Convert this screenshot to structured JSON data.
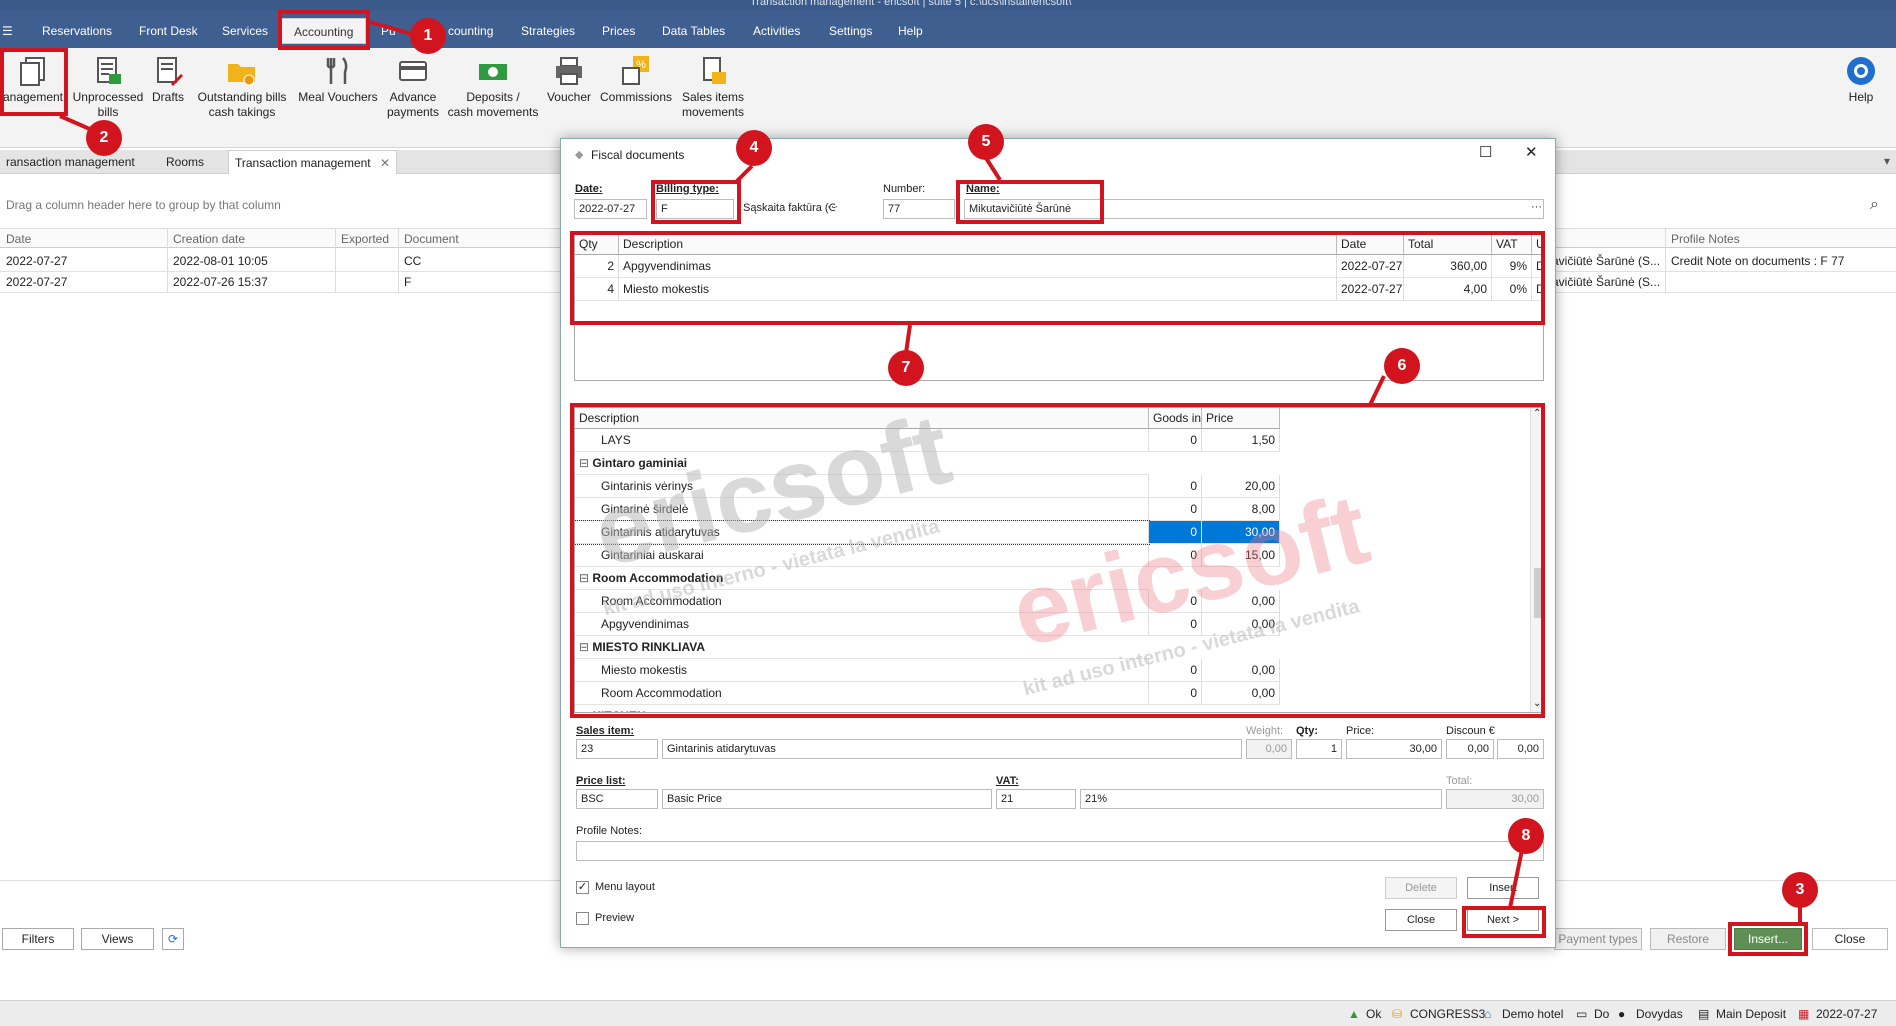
{
  "window": {
    "title": "Transaction management - ericsoft | suite 5 | c:\\ucs\\install\\ericsoft\\"
  },
  "menu": {
    "items": [
      "Reservations",
      "Front Desk",
      "Services",
      "Accounting",
      "Pu",
      "counting",
      "Strategies",
      "Prices",
      "Data Tables",
      "Activities",
      "Settings",
      "Help"
    ],
    "active": "Accounting"
  },
  "ribbon": {
    "buttons": [
      {
        "label1": "anagement",
        "label2": "",
        "icon": "documents-icon"
      },
      {
        "label1": "Unprocessed",
        "label2": "bills",
        "icon": "bills-icon"
      },
      {
        "label1": "Drafts",
        "label2": "",
        "icon": "drafts-icon"
      },
      {
        "label1": "Outstanding bills",
        "label2": "cash takings",
        "icon": "folder-coins-icon"
      },
      {
        "label1": "Meal Vouchers",
        "label2": "",
        "icon": "fork-knife-icon"
      },
      {
        "label1": "Advance",
        "label2": "payments",
        "icon": "card-icon"
      },
      {
        "label1": "Deposits /",
        "label2": "cash movements",
        "icon": "cash-icon"
      },
      {
        "label1": "Voucher",
        "label2": "",
        "icon": "printer-icon"
      },
      {
        "label1": "Commissions",
        "label2": "",
        "icon": "percent-icon"
      },
      {
        "label1": "Sales items",
        "label2": "movements",
        "icon": "sales-items-icon"
      }
    ],
    "help": "Help"
  },
  "tabs": [
    "ransaction management",
    "Rooms",
    "Transaction management"
  ],
  "group_hint": "Drag a column header here to group by that column",
  "grid": {
    "headers": [
      "Date",
      "Creation date",
      "Exported",
      "Document",
      "Profile Notes"
    ],
    "rows": [
      {
        "date": "2022-07-27",
        "created": "2022-08-01 10:05",
        "doc": "CC",
        "name": "avičiūtė Šarūnė (S...",
        "notes": "Credit Note on documents : F 77"
      },
      {
        "date": "2022-07-27",
        "created": "2022-07-26 15:37",
        "doc": "F",
        "name": "avičiūtė Šarūnė (S...",
        "notes": ""
      }
    ]
  },
  "bottom": {
    "filters": "Filters",
    "views": "Views",
    "payment_types": "Payment types",
    "restore": "Restore",
    "insert": "Insert...",
    "close": "Close"
  },
  "status": {
    "ok": "Ok",
    "db": "CONGRESS3",
    "hotel": "Demo hotel",
    "do": "Do",
    "user": "Dovydas",
    "deposit": "Main Deposit",
    "date": "2022-07-27"
  },
  "dialog": {
    "title": "Fiscal documents",
    "date_label": "Date:",
    "date_value": "2022-07-27",
    "billing_label": "Billing type:",
    "billing_value": "F",
    "billing_desc": "Sąskaita faktūra (Gryı",
    "number_label": "Number:",
    "number_value": "77",
    "name_label": "Name:",
    "name_value": "Mikutavičiūtė Šarūnė",
    "lines": {
      "headers": [
        "Qty",
        "Description",
        "Date",
        "Total",
        "VAT",
        "User"
      ],
      "rows": [
        {
          "qty": "2",
          "desc": "Apgyvendinimas",
          "date": "2022-07-27",
          "total": "360,00",
          "vat": "9%",
          "user": "Dovyda"
        },
        {
          "qty": "4",
          "desc": "Miesto mokestis",
          "date": "2022-07-27",
          "total": "4,00",
          "vat": "0%",
          "user": "Dovyda"
        }
      ]
    },
    "items": {
      "headers": [
        "Description",
        "Goods in",
        "Price"
      ],
      "rows": [
        {
          "type": "item",
          "desc": "LAYS",
          "goods": "0",
          "price": "1,50"
        },
        {
          "type": "group",
          "desc": "Gintaro gaminiai"
        },
        {
          "type": "item",
          "desc": "Gintarinis vėrinys",
          "goods": "0",
          "price": "20,00"
        },
        {
          "type": "item",
          "desc": "Gintarinė širdelė",
          "goods": "0",
          "price": "8,00"
        },
        {
          "type": "item",
          "desc": "Gintarinis atidarytuvas",
          "goods": "0",
          "price": "30,00",
          "selected": true
        },
        {
          "type": "item",
          "desc": "Gintariniai auskarai",
          "goods": "0",
          "price": "15,00"
        },
        {
          "type": "group",
          "desc": "Room Accommodation"
        },
        {
          "type": "item",
          "desc": "Room Accommodation",
          "goods": "0",
          "price": "0,00"
        },
        {
          "type": "item",
          "desc": "Apgyvendinimas",
          "goods": "0",
          "price": "0,00"
        },
        {
          "type": "group",
          "desc": "MIESTO RINKLIAVA"
        },
        {
          "type": "item",
          "desc": "Miesto mokestis",
          "goods": "0",
          "price": "0,00"
        },
        {
          "type": "item",
          "desc": "Room Accommodation",
          "goods": "0",
          "price": "0,00"
        },
        {
          "type": "group",
          "desc": "KITCHEN"
        }
      ]
    },
    "sales_item_label": "Sales item:",
    "sales_item_code": "23",
    "sales_item_name": "Gintarinis atidarytuvas",
    "weight_label": "Weight:",
    "weight_value": "0,00",
    "qty_label": "Qty:",
    "qty_value": "1",
    "price_label": "Price:",
    "price_value": "30,00",
    "discount_label": "Discoun €",
    "discount_pct": "0,00",
    "discount_eur": "0,00",
    "pricelist_label": "Price list:",
    "pricelist_code": "BSC",
    "pricelist_name": "Basic Price",
    "vat_label": "VAT:",
    "vat_code": "21",
    "vat_name": "21%",
    "total_label": "Total:",
    "total_value": "30,00",
    "profile_notes_label": "Profile Notes:",
    "menu_layout": "Menu layout",
    "preview": "Preview",
    "delete": "Delete",
    "insert": "Insert",
    "close": "Close",
    "next": "Next >"
  },
  "watermark": {
    "brand": "ericsoft",
    "tag": "kit ad uso interno - vietata la vendita"
  },
  "callouts": [
    "1",
    "2",
    "3",
    "4",
    "5",
    "6",
    "7",
    "8"
  ],
  "colors": {
    "menubar": "#3f5f91",
    "annotation": "#d2141e",
    "selection": "#0078d7"
  }
}
